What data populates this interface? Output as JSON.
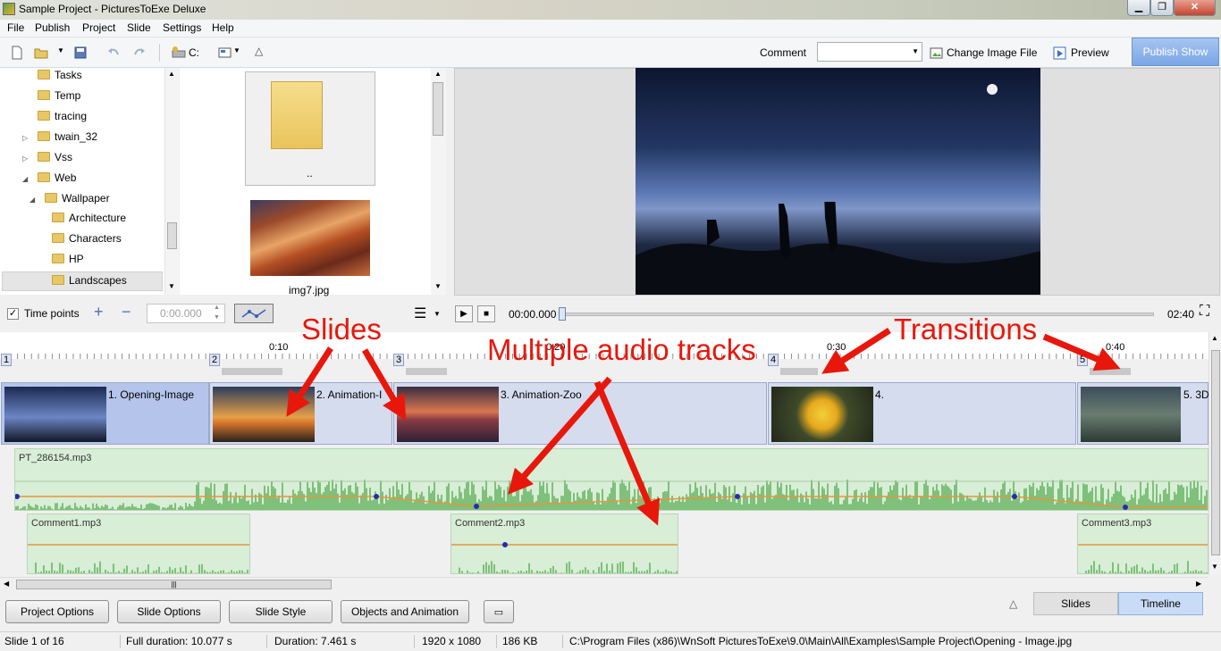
{
  "window": {
    "title": "Sample Project - PicturesToExe Deluxe",
    "min": "▁",
    "max": "❐",
    "close": "✕"
  },
  "menu": [
    "File",
    "Publish",
    "Project",
    "Slide",
    "Settings",
    "Help"
  ],
  "toolbar": {
    "drive": "C:",
    "comment_label": "Comment",
    "change_image": "Change Image File",
    "preview": "Preview",
    "publish": "Publish Show"
  },
  "tree": [
    "Tasks",
    "Temp",
    "tracing",
    "twain_32",
    "Vss",
    "Web",
    "Wallpaper",
    "Architecture",
    "Characters",
    "HP",
    "Landscapes"
  ],
  "thumbs": {
    "parent": "..",
    "img": "img7.jpg"
  },
  "controls": {
    "time_points": "Time points",
    "time_value": "0:00.000",
    "current_time": "00:00.000",
    "end_time": "02:40"
  },
  "ruler_labels": [
    "0:10",
    "0:20",
    "0:30",
    "0:40"
  ],
  "slides": [
    {
      "num": "1",
      "label": "1. Opening-Image"
    },
    {
      "num": "2",
      "label": "2. Animation-I"
    },
    {
      "num": "3",
      "label": "3. Animation-Zoo"
    },
    {
      "num": "4",
      "label": "4."
    },
    {
      "num": "5",
      "label": "5. 3D"
    }
  ],
  "audio": {
    "main": "PT_286154.mp3",
    "c1": "Comment1.mp3",
    "c2": "Comment2.mp3",
    "c3": "Comment3.mp3"
  },
  "bottom_buttons": [
    "Project Options",
    "Slide Options",
    "Slide Style",
    "Objects and Animation"
  ],
  "view_tabs": {
    "slides": "Slides",
    "timeline": "Timeline"
  },
  "status": {
    "slide": "Slide 1 of 16",
    "full": "Full duration: 10.077 s",
    "duration": "Duration: 7.461 s",
    "res": "1920 x 1080",
    "size": "186 KB",
    "path": "C:\\Program Files (x86)\\WnSoft PicturesToExe\\9.0\\Main\\All\\Examples\\Sample Project\\Opening - Image.jpg"
  },
  "annotations": {
    "slides": "Slides",
    "audio": "Multiple audio tracks",
    "transitions": "Transitions"
  },
  "colors": {
    "arrow": "#e8170b",
    "selected_tab": "#c9dcf7",
    "waveform": "#7fc07a",
    "volume_line": "#e8943c",
    "node": "#1f2fb0"
  }
}
